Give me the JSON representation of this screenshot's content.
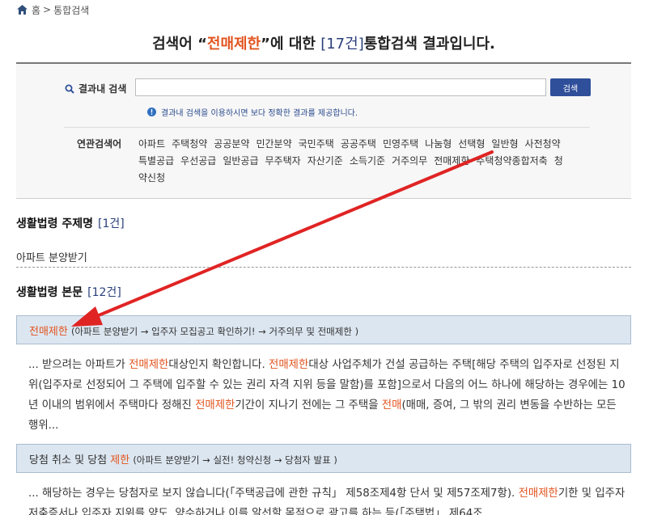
{
  "breadcrumb": {
    "home": "홈",
    "separator": ">",
    "current": "통합검색",
    "home_icon": "home-icon"
  },
  "title": {
    "prefix": "검색어 “",
    "keyword": "전매제한",
    "middle": "”에 대한 ",
    "count": "[17건]",
    "suffix": "통합검색 결과입니다."
  },
  "search": {
    "label": "결과내 검색",
    "input_value": "",
    "button": "검색",
    "notice": "결과내 검색을 이용하시면 보다 정확한 결과를 제공합니다.",
    "related_label": "연관검색어",
    "related_terms": [
      "아파트",
      "주택청약",
      "공공분약",
      "민간분약",
      "국민주택",
      "공공주택",
      "민영주택",
      "나눔형",
      "선택형",
      "일반형",
      "사전청약",
      "특별공급",
      "우선공급",
      "일반공급",
      "무주택자",
      "자산기준",
      "소득기준",
      "거주의무",
      "전매제한",
      "주택청약종합저축",
      "청약신청"
    ]
  },
  "section1": {
    "title": "생활법령 주제명",
    "count": "[1건]",
    "items": [
      "아파트 분양받기"
    ]
  },
  "section2": {
    "title": "생활법령 본문",
    "count": "[12건]"
  },
  "results": [
    {
      "title_pre": "",
      "title_hl": "전매제한",
      "title_post": "",
      "path": "(아파트 분양받기 → 입주자 모집공고 확인하기! → 거주의무 및 전매제한 )",
      "body": [
        {
          "t": "... 받으려는 아파트가 "
        },
        {
          "t": "전매제한",
          "hl": true
        },
        {
          "t": "대상인지 확인합니다. "
        },
        {
          "t": "전매제한",
          "hl": true
        },
        {
          "t": "대상 사업주체가 건설 공급하는 주택[해당 주택의 입주자로 선정된 지위(입주자로 선정되어 그 주택에 입주할 수 있는 권리 자격 지위 등을 말함)를 포함]으로서 다음의 어느 하나에 해당하는 경우에는 10년 이내의 범위에서 주택마다 정해진 "
        },
        {
          "t": "전매제한",
          "hl": true
        },
        {
          "t": "기간이 지나기 전에는 그 주택을 "
        },
        {
          "t": "전매",
          "hl": true
        },
        {
          "t": "(매매, 증여, 그 밖의 권리 변동을 수반하는 모든 행위..."
        }
      ]
    },
    {
      "title_pre": "당첨 취소 및 당첨 ",
      "title_hl": "제한",
      "title_post": "",
      "path": "(아파트 분양받기 → 실전! 청약신청 → 당첨자 발표 )",
      "body": [
        {
          "t": "... 해당하는 경우는 당첨자로 보지 않습니다(「주택공급에 관한 규칙」 제58조제4항 단서 및 제57조제7항). "
        },
        {
          "t": "전매제한",
          "hl": true
        },
        {
          "t": "기한 및 입주자저축증서나 입주자 지위를 양도, 양수하거나 이를 알선할 목적으로 광고를 하는 등(「주택법」 제64조..."
        }
      ]
    }
  ],
  "colors": {
    "accent": "#e2541f",
    "header_bg": "#dce6f0",
    "button": "#2f4f9a",
    "arrow": "#e02424"
  }
}
